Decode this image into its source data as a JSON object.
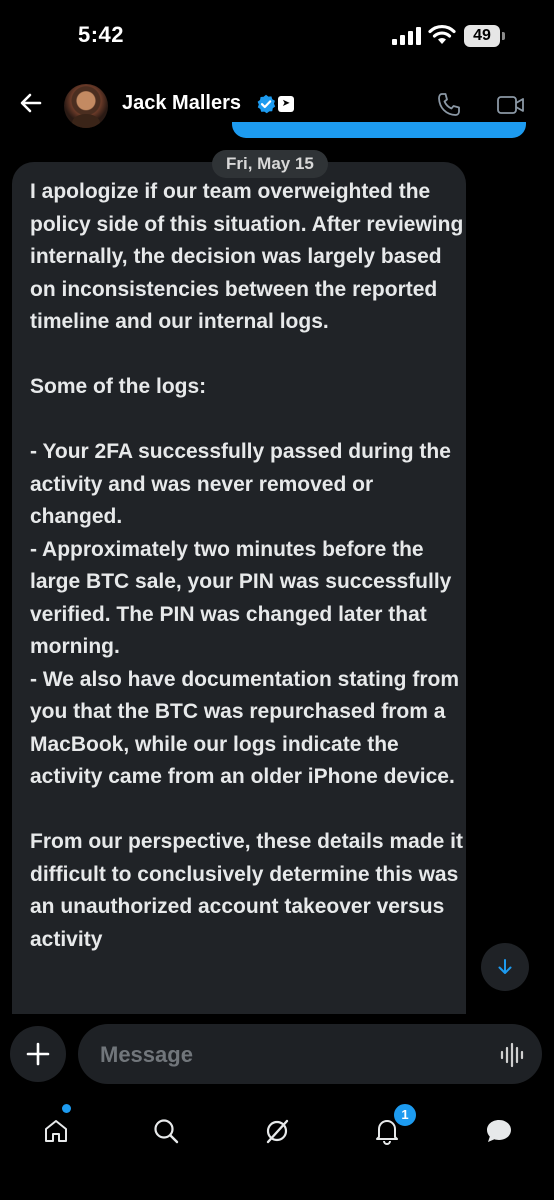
{
  "status_bar": {
    "time": "5:42",
    "battery": "49"
  },
  "header": {
    "contact_name": "Jack Mallers",
    "verified_icon": "verified-badge-icon",
    "affiliate_icon": "affiliate-badge-icon"
  },
  "conversation": {
    "date_divider": "Fri, May 15",
    "message": "I apologize if our team overweighted the policy side of this situation. After reviewing internally, the decision was largely based on inconsistencies between the reported timeline and our internal logs.\n\nSome of the logs:\n\n- Your 2FA successfully passed during the activity and was never removed or changed.\n- Approximately two minutes before the large BTC sale, your PIN was successfully verified. The PIN was changed later that morning.\n- We also have documentation stating from you that the BTC was repurchased from a MacBook, while our logs indicate the activity came from an older iPhone device.\n\nFrom our perspective, these details made it difficult to conclusively determine this was an unauthorized account takeover versus activity"
  },
  "composer": {
    "placeholder": "Message"
  },
  "tabbar": {
    "notifications_badge": "1"
  },
  "colors": {
    "accent": "#1d9bf0",
    "bubble": "#202327",
    "background": "#000000"
  }
}
